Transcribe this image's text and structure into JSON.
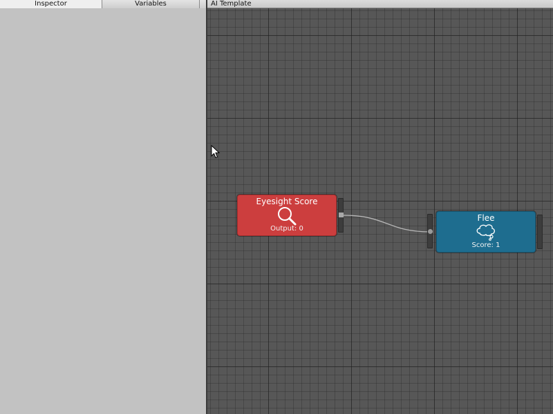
{
  "left_tabs": [
    {
      "label": "Inspector",
      "active": true
    },
    {
      "label": "Variables",
      "active": false
    }
  ],
  "graph": {
    "title": "AI Template",
    "nodes": [
      {
        "title": "Eyesight Score",
        "subtitle": "Output: 0",
        "icon": "magnifier-icon",
        "color": "#cc3e3e"
      },
      {
        "title": "Flee",
        "subtitle": "Score: 1",
        "icon": "thought-bubble-icon",
        "color": "#1e6d8f"
      }
    ]
  },
  "colors": {
    "canvas": "#575757",
    "panel": "#c2c2c2",
    "red_node": "#cc3e3e",
    "blue_node": "#1e6d8f"
  }
}
